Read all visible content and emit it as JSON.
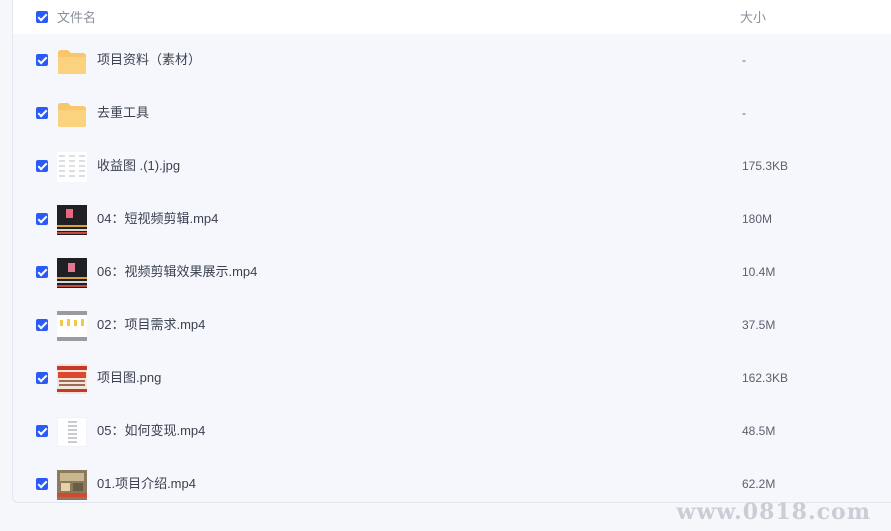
{
  "header": {
    "name_label": "文件名",
    "size_label": "大小"
  },
  "files": [
    {
      "name": "项目资料（素材）",
      "size": "-",
      "icon": "folder-icon"
    },
    {
      "name": "去重工具",
      "size": "-",
      "icon": "folder-icon"
    },
    {
      "name": "收益图 .(1).jpg",
      "size": "175.3KB",
      "icon": "image-thumbnail"
    },
    {
      "name": "04：短视频剪辑.mp4",
      "size": "180M",
      "icon": "video-thumbnail"
    },
    {
      "name": "06：视频剪辑效果展示.mp4",
      "size": "10.4M",
      "icon": "video-thumbnail"
    },
    {
      "name": "02：项目需求.mp4",
      "size": "37.5M",
      "icon": "video-thumbnail"
    },
    {
      "name": "项目图.png",
      "size": "162.3KB",
      "icon": "image-thumbnail"
    },
    {
      "name": "05：如何变现.mp4",
      "size": "48.5M",
      "icon": "video-thumbnail"
    },
    {
      "name": "01.项目介绍.mp4",
      "size": "62.2M",
      "icon": "video-thumbnail"
    }
  ],
  "watermark": "www.0818.com",
  "colors": {
    "accent": "#2b5bf6",
    "folder": "#f9c66b",
    "background": "#f6f7fd"
  }
}
